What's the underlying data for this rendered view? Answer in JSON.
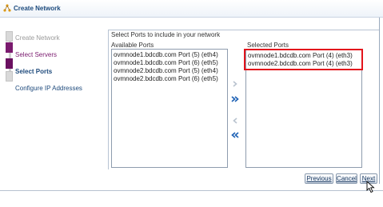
{
  "window": {
    "title": "Create Network"
  },
  "train": {
    "steps": [
      {
        "label": "Create Network",
        "state": "visited-disabled"
      },
      {
        "label": "Select Servers",
        "state": "visited"
      },
      {
        "label": "Select Ports",
        "state": "current"
      },
      {
        "label": "Configure IP Addresses",
        "state": "next"
      }
    ]
  },
  "main": {
    "instruction": "Select Ports to include in your network",
    "available": {
      "label": "Available Ports",
      "items": [
        "ovmnode1.bdcdb.com Port (5) (eth4)",
        "ovmnode1.bdcdb.com Port (6) (eth5)",
        "ovmnode2.bdcdb.com Port (5) (eth4)",
        "ovmnode2.bdcdb.com Port (6) (eth5)"
      ]
    },
    "selected": {
      "label": "Selected Ports",
      "items": [
        "ovmnode1.bdcdb.com Port (4) (eth3)",
        "ovmnode2.bdcdb.com Port (4) (eth3)"
      ]
    },
    "shuttle": {
      "move": "move-right-icon",
      "move_all": "move-all-right-icon",
      "remove": "move-left-icon",
      "remove_all": "move-all-left-icon"
    }
  },
  "footer": {
    "previous_label": "Previous",
    "cancel_label": "Cancel",
    "next_label": "Next"
  },
  "colors": {
    "title": "#1c4a7d",
    "visited_step": "#7a1a6e",
    "current_step": "#1e4a7c",
    "highlight": "#e3141c",
    "shuttle_active": "#1a5fb4",
    "shuttle_disabled": "#b9c3cf"
  }
}
